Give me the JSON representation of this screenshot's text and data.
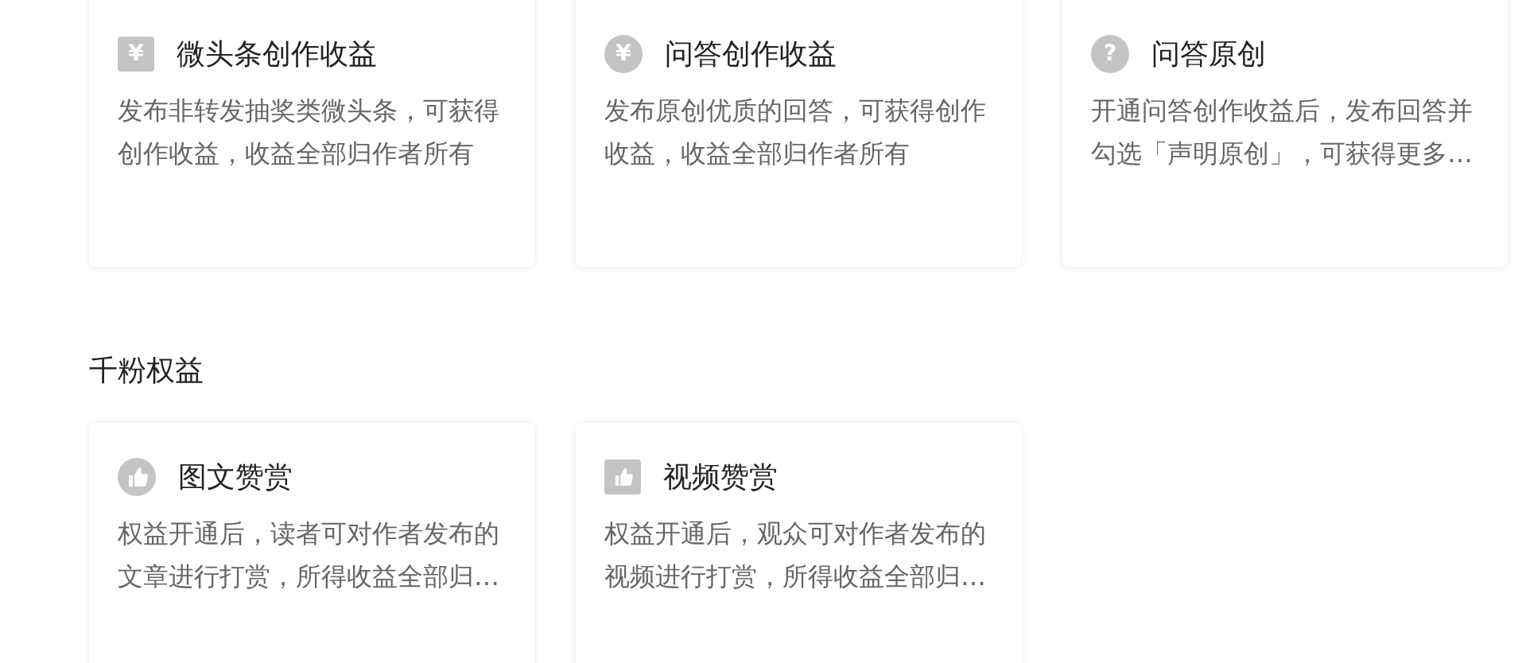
{
  "sections": [
    {
      "cards": [
        {
          "kind": "square",
          "icon_glyph": "¥",
          "title": "微头条创作收益",
          "description": "发布非转发抽奖类微头条，可获得创作收益，收益全部归作者所有"
        },
        {
          "kind": "circle",
          "icon_glyph": "¥",
          "title": "问答创作收益",
          "description": "发布原创优质的回答，可获得创作收益，收益全部归作者所有"
        },
        {
          "kind": "circle",
          "icon_glyph": "?",
          "title": "问答原创",
          "description": "开通问答创作收益后，发布回答并勾选「声明原创」，可获得更多…"
        }
      ]
    },
    {
      "title": "千粉权益",
      "cards": [
        {
          "kind": "circle",
          "title": "图文赞赏",
          "description": "权益开通后，读者可对作者发布的文章进行打赏，所得收益全部归…"
        },
        {
          "kind": "square",
          "title": "视频赞赏",
          "description": "权益开通后，观众可对作者发布的视频进行打赏，所得收益全部归…"
        }
      ]
    }
  ]
}
